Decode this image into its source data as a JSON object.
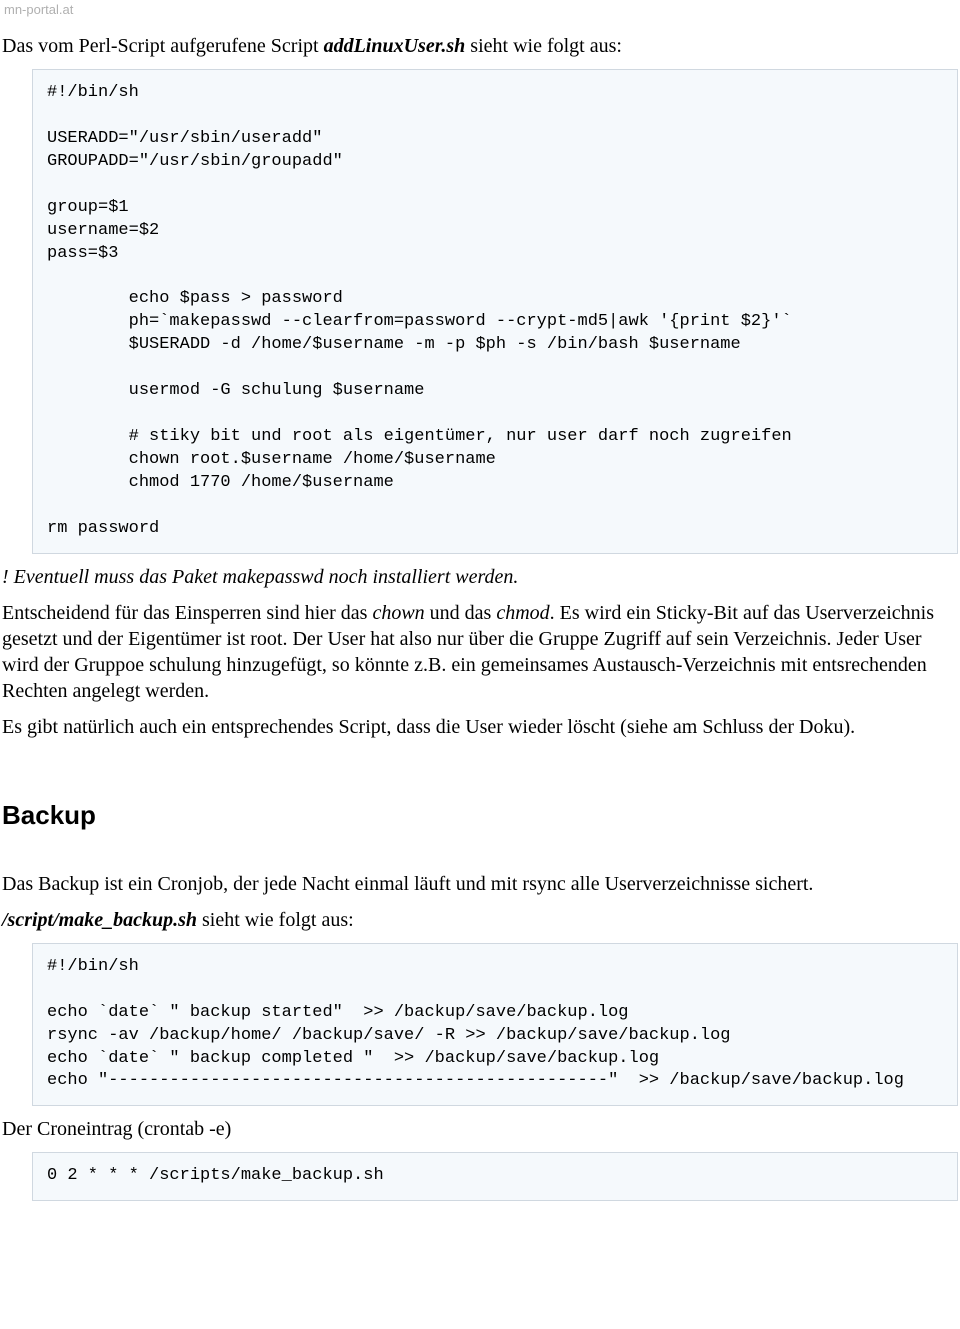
{
  "url": "mn-portal.at",
  "intro": {
    "prefix": "Das vom Perl-Script aufgerufene Script ",
    "script_name": "addLinuxUser.sh",
    "suffix": " sieht wie folgt aus:"
  },
  "code1": "#!/bin/sh\n\nUSERADD=\"/usr/sbin/useradd\"\nGROUPADD=\"/usr/sbin/groupadd\"\n\ngroup=$1\nusername=$2\npass=$3\n\n        echo $pass > password\n        ph=`makepasswd --clearfrom=password --crypt-md5|awk '{print $2}'`\n        $USERADD -d /home/$username -m -p $ph -s /bin/bash $username\n\n        usermod -G schulung $username\n\n        # stiky bit und root als eigentümer, nur user darf noch zugreifen\n        chown root.$username /home/$username\n        chmod 1770 /home/$username\n\nrm password",
  "note_makepasswd": "! Eventuell muss das Paket makepasswd noch installiert werden.",
  "para_chown": {
    "p1": "Entscheidend für das Einsperren sind hier das ",
    "em1": "chown",
    "p2": " und das ",
    "em2": "chmod",
    "p3": ". Es wird ein Sticky-Bit auf das Userverzeichnis gesetzt und der Eigentümer ist root. Der User hat also nur über die Gruppe Zugriff auf sein Verzeichnis. Jeder User wird der Gruppoe schulung hinzugefügt, so könnte z.B. ein gemeinsames Austausch-Verzeichnis mit entsrechenden Rechten angelegt werden."
  },
  "para_delete": "Es gibt natürlich auch ein entsprechendes Script, dass die User wieder löscht (siehe am Schluss der Doku).",
  "heading_backup": "Backup",
  "backup_intro": "Das Backup ist ein Cronjob, der jede Nacht einmal läuft und mit rsync alle Userverzeichnisse sichert.",
  "backup_script_line": {
    "script_name": "/script/make_backup.sh",
    "suffix": " sieht wie folgt aus:"
  },
  "code2": "#!/bin/sh\n\necho `date` \" backup started\"  >> /backup/save/backup.log\nrsync -av /backup/home/ /backup/save/ -R >> /backup/save/backup.log\necho `date` \" backup completed \"  >> /backup/save/backup.log\necho \"-------------------------------------------------\"  >> /backup/save/backup.log\n",
  "cron_label": "Der Croneintrag (crontab -e)",
  "code3": "0 2 * * * /scripts/make_backup.sh"
}
